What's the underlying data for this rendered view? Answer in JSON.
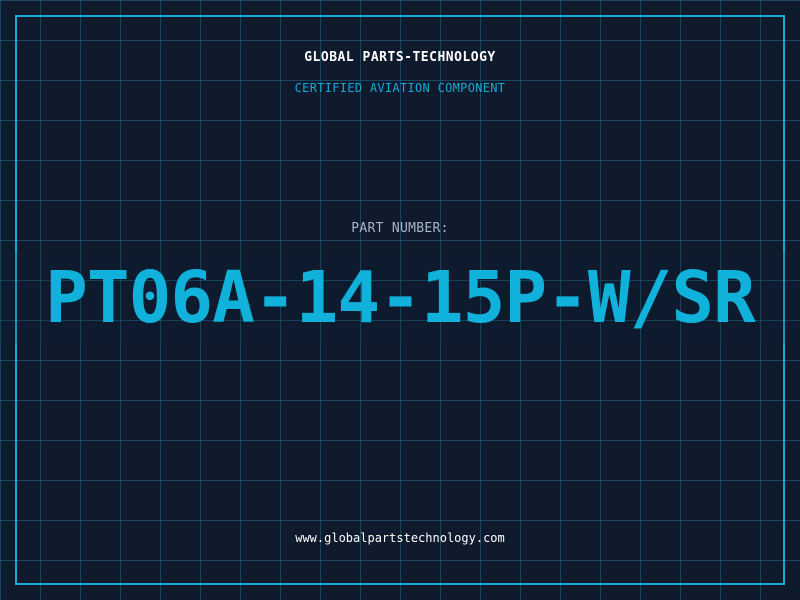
{
  "header": {
    "company": "GLOBAL PARTS-TECHNOLOGY",
    "tagline": "CERTIFIED AVIATION COMPONENT"
  },
  "part": {
    "label": "PART NUMBER:",
    "number": "PT06A-14-15P-W/SR"
  },
  "footer": {
    "url": "www.globalpartstechnology.com"
  },
  "colors": {
    "background": "#0f1a2d",
    "grid": "#1e6e8c",
    "accent": "#17a9d1",
    "part_number": "#10b2dc",
    "label": "#a9b6c8",
    "text": "#ffffff"
  }
}
